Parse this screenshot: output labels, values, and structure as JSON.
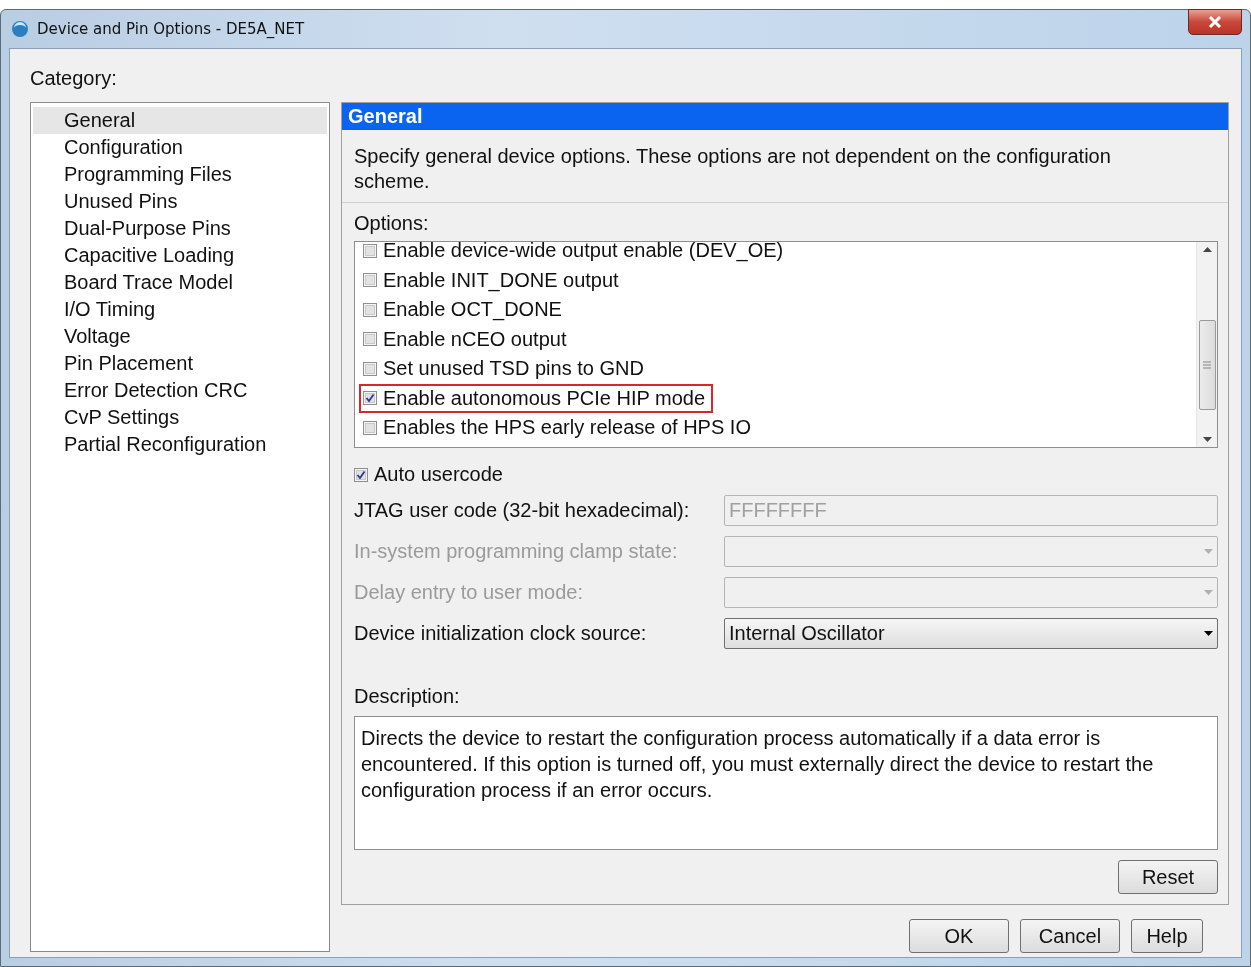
{
  "window": {
    "title": "Device and Pin Options - DE5A_NET"
  },
  "category": {
    "label": "Category:",
    "items": [
      {
        "label": "General",
        "selected": true
      },
      {
        "label": "Configuration",
        "selected": false
      },
      {
        "label": "Programming Files",
        "selected": false
      },
      {
        "label": "Unused Pins",
        "selected": false
      },
      {
        "label": "Dual-Purpose Pins",
        "selected": false
      },
      {
        "label": "Capacitive Loading",
        "selected": false
      },
      {
        "label": "Board Trace Model",
        "selected": false
      },
      {
        "label": "I/O Timing",
        "selected": false
      },
      {
        "label": "Voltage",
        "selected": false
      },
      {
        "label": "Pin Placement",
        "selected": false
      },
      {
        "label": "Error Detection CRC",
        "selected": false
      },
      {
        "label": "CvP Settings",
        "selected": false
      },
      {
        "label": "Partial Reconfiguration",
        "selected": false
      }
    ]
  },
  "panel": {
    "title": "General",
    "intro": "Specify general device options. These options are not dependent on the configuration scheme.",
    "options_label": "Options:",
    "options": [
      {
        "label": "Enable device-wide output enable (DEV_OE)",
        "checked": false,
        "highlighted": false
      },
      {
        "label": "Enable INIT_DONE output",
        "checked": false,
        "highlighted": false
      },
      {
        "label": "Enable OCT_DONE",
        "checked": false,
        "highlighted": false
      },
      {
        "label": "Enable nCEO output",
        "checked": false,
        "highlighted": false
      },
      {
        "label": "Set unused TSD pins to GND",
        "checked": false,
        "highlighted": false
      },
      {
        "label": "Enable autonomous PCIe HIP mode",
        "checked": true,
        "highlighted": true
      },
      {
        "label": "Enables the HPS early release of HPS IO",
        "checked": false,
        "highlighted": false
      }
    ],
    "auto_usercode": {
      "label": "Auto usercode",
      "checked": true
    },
    "fields": [
      {
        "kind": "text",
        "label": "JTAG user code (32-bit hexadecimal):",
        "value": "FFFFFFFF",
        "label_disabled": false,
        "disabled": true
      },
      {
        "kind": "combo",
        "label": "In-system programming clamp state:",
        "label_disabled": true,
        "disabled": true
      },
      {
        "kind": "combo",
        "label": "Delay entry to user mode:",
        "label_disabled": true,
        "disabled": true
      },
      {
        "kind": "combo",
        "label": "Device initialization clock source:",
        "value": "Internal Oscillator",
        "label_disabled": false,
        "disabled": false
      }
    ],
    "description": {
      "label": "Description:",
      "text": "Directs the device to restart the configuration process automatically if a data error is encountered. If this option is turned off, you must externally direct the device to restart the configuration process if an error occurs."
    },
    "reset_button": "Reset"
  },
  "buttons": [
    "OK",
    "Cancel",
    "Help"
  ]
}
